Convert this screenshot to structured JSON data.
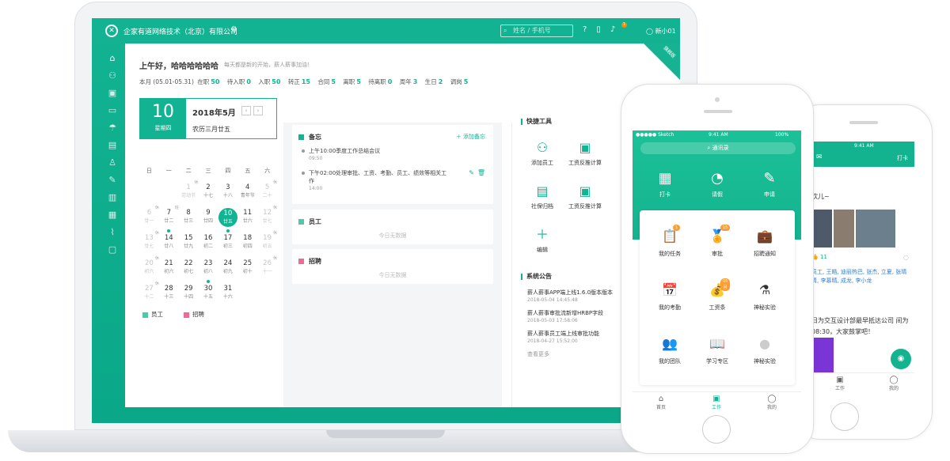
{
  "desktop": {
    "company": "企家有道网络技术（北京）有限公司",
    "search_placeholder": "姓名 / 手机号",
    "notif_count": "1",
    "username": "新小01",
    "corner_tag": "旗舰版",
    "greeting": "上午好，哈哈哈哈哈哈",
    "greeting_sub": "每天都是新的开始，薪人薪事加油！",
    "stats_period": "本月 (05.01-05.31)",
    "stats": [
      {
        "label": "在职",
        "value": "50"
      },
      {
        "label": "待入职",
        "value": "0"
      },
      {
        "label": "入职",
        "value": "50"
      },
      {
        "label": "转正",
        "value": "15"
      },
      {
        "label": "合同",
        "value": "5"
      },
      {
        "label": "离职",
        "value": "5"
      },
      {
        "label": "待离职",
        "value": "0"
      },
      {
        "label": "周年",
        "value": "3"
      },
      {
        "label": "生日",
        "value": "2"
      },
      {
        "label": "调岗",
        "value": "5"
      }
    ],
    "calendar": {
      "day": "10",
      "weekday": "星期四",
      "year_month": "2018年5月",
      "lunar": "农历三月廿五",
      "week_headers": [
        "日",
        "一",
        "二",
        "三",
        "四",
        "五",
        "六"
      ],
      "legend_employee": "员工",
      "legend_recruit": "招聘"
    },
    "memo": {
      "title": "备忘",
      "add": "添加备忘",
      "items": [
        {
          "text": "上午10:00季度工作总结会议",
          "time": "09:50"
        },
        {
          "text": "下午02:00处理审批、工资、考勤、员工、绩效等相关工作",
          "time": "14:00"
        }
      ]
    },
    "employee_card": {
      "title": "员工",
      "empty": "今日无数据"
    },
    "recruit_card": {
      "title": "招聘",
      "empty": "今日无数据"
    },
    "tools_title": "快捷工具",
    "tools": [
      "添加员工",
      "工资反推计算",
      "社保归档",
      "工资反推计算",
      "编辑"
    ],
    "notice_title": "系统公告",
    "notices": [
      {
        "text": "薪人薪事APP端上线1.6.0版本版本",
        "time": "2018-05-04 14:45:48"
      },
      {
        "text": "薪人薪事审批流新增HRBP字段",
        "time": "2018-05-03 17:58:06"
      },
      {
        "text": "薪人薪事员工端上线审批功能",
        "time": "2018-04-27 15:52:00"
      }
    ],
    "notice_more": "查看更多"
  },
  "phone1": {
    "carrier": "Sketch",
    "time": "9:41 AM",
    "battery": "100%",
    "search": "通讯录",
    "quick": [
      "打卡",
      "请假",
      "申请"
    ],
    "apps": [
      {
        "label": "我的任务",
        "badge": "1"
      },
      {
        "label": "审批",
        "badge": "15"
      },
      {
        "label": "招聘通知",
        "badge": ""
      },
      {
        "label": "我的考勤",
        "badge": ""
      },
      {
        "label": "工资条",
        "badge": "05月"
      },
      {
        "label": "神秘实验",
        "badge": ""
      },
      {
        "label": "我的团队",
        "badge": ""
      },
      {
        "label": "学习专区",
        "badge": ""
      },
      {
        "label": "神秘实验",
        "badge": ""
      }
    ],
    "tabs": [
      "首页",
      "工作",
      "我的"
    ]
  },
  "phone2": {
    "time": "9:41 AM",
    "punch": "打卡",
    "post_head": "欢儿~",
    "likes": "11",
    "names": "员工, 王皓, 迪丽热巴, 张杰, 立夏, 张晴 倩, 李慕晴, 成龙, 李小龙",
    "post_text": "日为交互设计部最早抵达公司 间为08:30，大家鼓掌吧！",
    "tabs": [
      "工作",
      "我的"
    ]
  }
}
